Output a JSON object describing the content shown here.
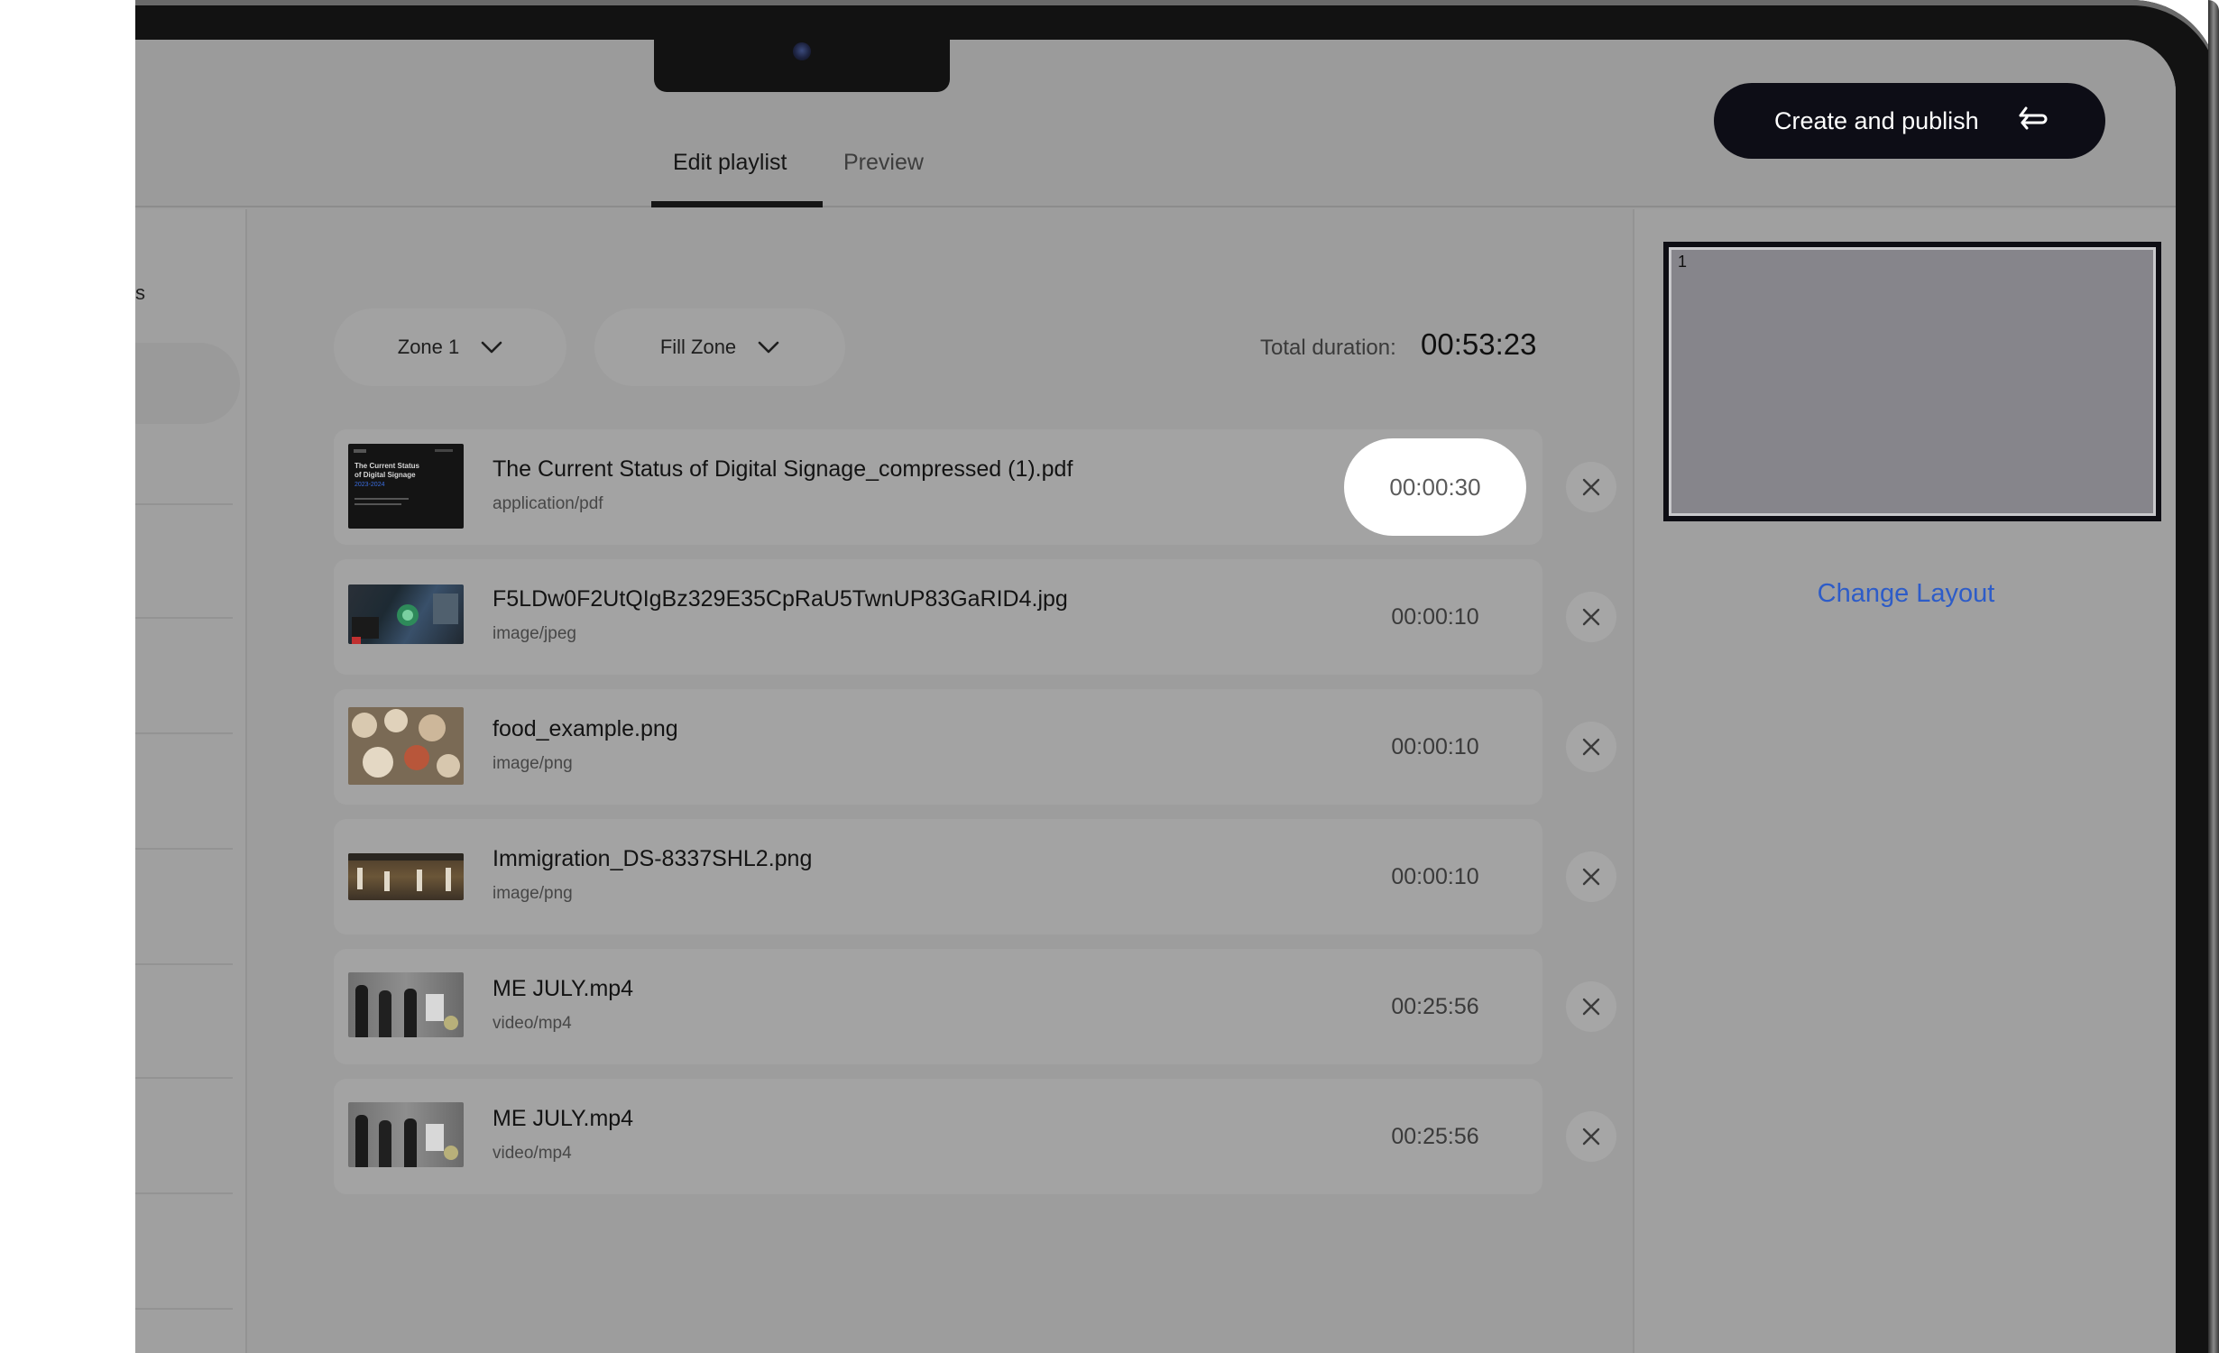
{
  "header": {
    "tabs": [
      {
        "label": "Edit playlist",
        "active": true
      },
      {
        "label": "Preview",
        "active": false
      }
    ],
    "publish_label": "Create and publish",
    "publish_icon": "return-arrow-icon"
  },
  "sidebar": {
    "label_fragment": "s"
  },
  "toolbar": {
    "zone_select": "Zone 1",
    "fill_select": "Fill Zone",
    "total_duration_label": "Total duration:",
    "total_duration_value": "00:53:23"
  },
  "playlist": [
    {
      "name": "The Current Status of Digital Signage_compressed (1).pdf",
      "type": "application/pdf",
      "duration": "00:00:30",
      "thumb_title": "The Current Status of Digital Signage",
      "thumb_year": "2023-2024"
    },
    {
      "name": "F5LDw0F2UtQIgBz329E35CpRaU5TwnUP83GaRID4.jpg",
      "type": "image/jpeg",
      "duration": "00:00:10"
    },
    {
      "name": "food_example.png",
      "type": "image/png",
      "duration": "00:00:10"
    },
    {
      "name": "Immigration_DS-8337SHL2.png",
      "type": "image/png",
      "duration": "00:00:10"
    },
    {
      "name": "ME JULY.mp4",
      "type": "video/mp4",
      "duration": "00:25:56"
    },
    {
      "name": "ME JULY.mp4",
      "type": "video/mp4",
      "duration": "00:25:56"
    }
  ],
  "layout_panel": {
    "zone_number": "1",
    "change_layout_label": "Change Layout"
  },
  "colors": {
    "overlay": "#9d9d9d",
    "publish_button": "#0d0d16",
    "link": "#2d5cc8"
  }
}
